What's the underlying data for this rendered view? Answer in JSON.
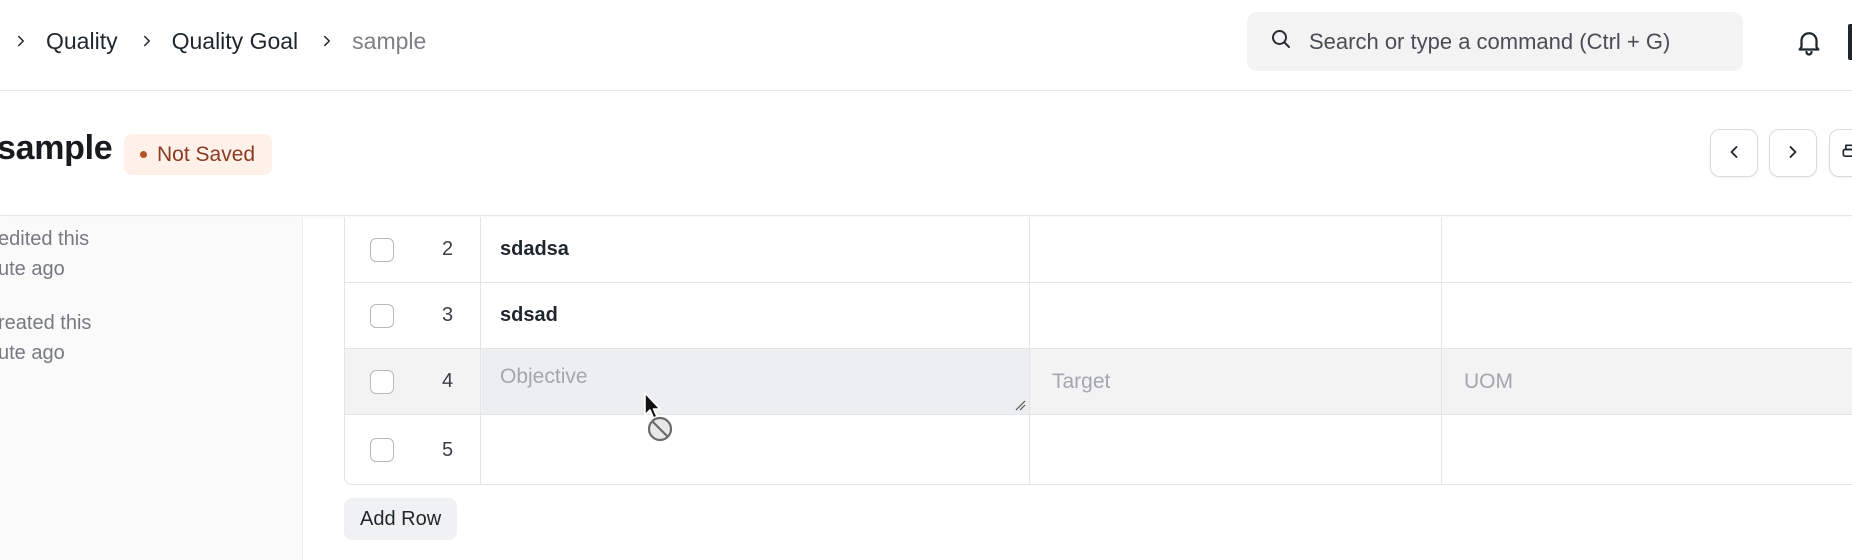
{
  "breadcrumb": {
    "items": [
      {
        "label": "Quality"
      },
      {
        "label": "Quality Goal"
      },
      {
        "label": "sample"
      }
    ]
  },
  "search": {
    "placeholder": "Search or type a command (Ctrl + G)"
  },
  "page": {
    "title": "sample",
    "status": "Not Saved"
  },
  "sidebar": {
    "activity": [
      {
        "line1": "edited this",
        "line2": "ute ago"
      },
      {
        "line1": "reated this",
        "line2": "ute ago"
      }
    ]
  },
  "table": {
    "rows": [
      {
        "idx": "2",
        "objective": "sdadsa",
        "target": "",
        "uom": ""
      },
      {
        "idx": "3",
        "objective": "sdsad",
        "target": "",
        "uom": ""
      },
      {
        "idx": "4",
        "objective": "",
        "target": "",
        "uom": ""
      },
      {
        "idx": "5",
        "objective": "",
        "target": "",
        "uom": ""
      }
    ],
    "placeholders": {
      "objective": "Objective",
      "target": "Target",
      "uom": "UOM"
    }
  },
  "actions": {
    "add_row": "Add Row"
  },
  "icons": {
    "breadcrumb_sep": "chevron-right-icon",
    "search": "search-icon",
    "notifications": "bell-icon",
    "prev": "chevron-left-icon",
    "next": "chevron-right-icon",
    "print": "printer-icon",
    "cursor": "not-allowed-cursor-icon"
  },
  "colors": {
    "status_bg": "#fff1ea",
    "status_text": "#8a3a1f",
    "active_row": "#f3f3f4"
  }
}
